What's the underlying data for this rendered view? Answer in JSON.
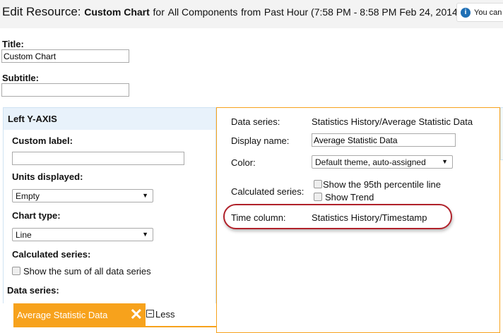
{
  "header": {
    "prefix": "Edit Resource:",
    "resource": "Custom Chart",
    "for": "for",
    "scope": "All Components",
    "from": "from",
    "period": "Past Hour (7:58 PM - 8:58 PM Feb 24, 2014)",
    "info_text": "You can"
  },
  "form": {
    "title_label": "Title:",
    "title_value": "Custom Chart",
    "subtitle_label": "Subtitle:",
    "subtitle_value": ""
  },
  "left_axis": {
    "heading": "Left Y-AXIS",
    "custom_label": "Custom label:",
    "custom_value": "",
    "units_label": "Units displayed:",
    "units_value": "Empty",
    "chart_type_label": "Chart type:",
    "chart_type_value": "Line",
    "calc_label": "Calculated series:",
    "sum_checkbox": "Show the sum of all data series",
    "data_series_label": "Data series:",
    "series_name": "Average Statistic Data",
    "less": "Less"
  },
  "series_detail": {
    "data_series_label": "Data series:",
    "data_series_value": "Statistics History/Average Statistic Data",
    "display_name_label": "Display name:",
    "display_name_value": "Average Statistic Data",
    "color_label": "Color:",
    "color_value": "Default theme, auto-assigned",
    "calc_label": "Calculated series:",
    "pct_checkbox": "Show the 95th percentile line",
    "trend_checkbox": "Show Trend",
    "time_label": "Time column:",
    "time_value": "Statistics History/Timestamp"
  },
  "colors": {
    "accent": "#f7a21c",
    "highlight": "#b0212a",
    "panel_header": "#e8f2fb"
  }
}
